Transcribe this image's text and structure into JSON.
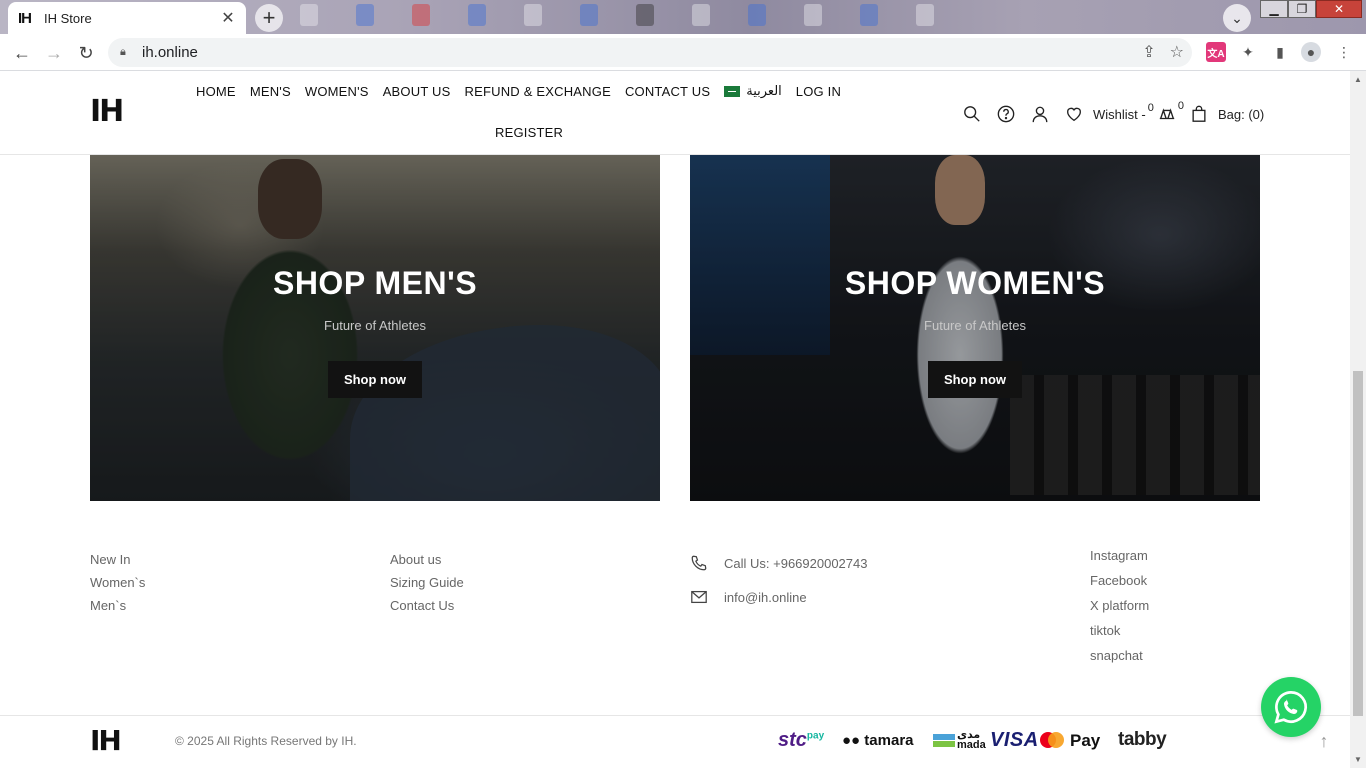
{
  "browser": {
    "tab_title": "IH Store",
    "tab_favicon": "IH",
    "url": "ih.online"
  },
  "header": {
    "logo": "IH",
    "nav": [
      "HOME",
      "MEN'S",
      "WOMEN'S",
      "ABOUT US",
      "REFUND & EXCHANGE",
      "CONTACT US"
    ],
    "language_label": "العربية",
    "login_label": "LOG IN",
    "register_label": "REGISTER",
    "wishlist_label": "Wishlist -",
    "wishlist_count": "0",
    "compare_count": "0",
    "bag_label": "Bag: (0)"
  },
  "banners": {
    "men": {
      "title": "SHOP MEN'S",
      "subtitle": "Future of Athletes",
      "button": "Shop now"
    },
    "women": {
      "title": "SHOP WOMEN'S",
      "subtitle": "Future of Athletes",
      "button": "Shop now"
    }
  },
  "footer": {
    "col1": [
      "New In",
      "Women`s",
      "Men`s"
    ],
    "col2": [
      "About us",
      "Sizing Guide",
      "Contact Us"
    ],
    "phone": "Call Us: +966920002743",
    "email": "info@ih.online",
    "social": [
      "Instagram",
      "Facebook",
      "X platform",
      "tiktok",
      "snapchat"
    ],
    "logo": "IH",
    "copyright": "© 2025 All Rights Reserved by IH."
  },
  "payments": {
    "stc": "stc",
    "stc_pay": "pay",
    "tamara": "tamara",
    "mada": "مدى mada",
    "visa": "VISA",
    "applepay": "Pay",
    "tabby": "tabby"
  },
  "icons": [
    "search-icon",
    "help-icon",
    "user-icon",
    "heart-icon",
    "compare-icon",
    "bag-icon",
    "phone-icon",
    "mail-icon",
    "whatsapp-icon",
    "arrow-up-icon"
  ],
  "colors": {
    "whatsapp": "#25d366",
    "button_dark": "#121212",
    "close_red": "#c7433a"
  }
}
